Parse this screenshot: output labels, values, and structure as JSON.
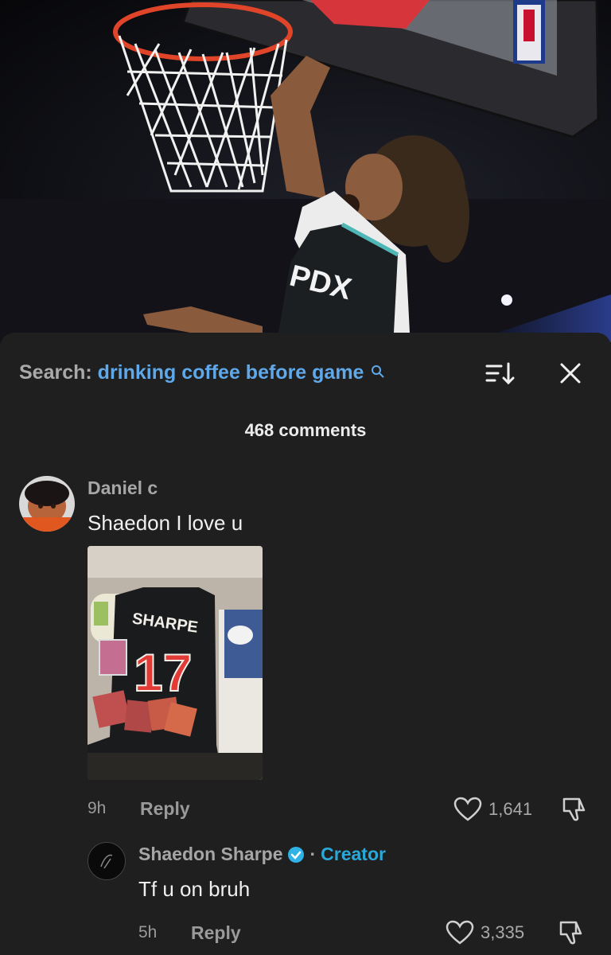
{
  "search": {
    "label": "Search:",
    "term": "drinking coffee before game"
  },
  "comments_header": {
    "count_text": "468 comments"
  },
  "comments": [
    {
      "author": "Daniel c",
      "text": "Shaedon I love u",
      "time": "9h",
      "reply_label": "Reply",
      "likes": "1,641"
    },
    {
      "author": "Shaedon Sharpe",
      "badge": "Creator",
      "separator": "·",
      "text": "Tf u on bruh",
      "time": "5h",
      "reply_label": "Reply",
      "likes": "3,335"
    }
  ],
  "colors": {
    "accent_blue": "#5fa8e9",
    "creator_blue": "#29a9d8",
    "sheet_bg": "#1f1f1f"
  }
}
